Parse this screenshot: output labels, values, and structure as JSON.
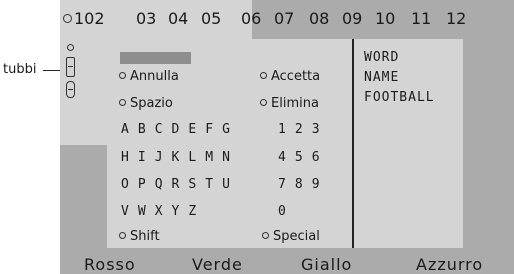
{
  "callout": "tubbi",
  "channels": [
    "102",
    "03",
    "04",
    "05",
    "06",
    "07",
    "08",
    "09",
    "10",
    "11",
    "12"
  ],
  "options": {
    "cancel": "Annulla",
    "accept": "Accetta",
    "space": "Spazio",
    "delete": "Elimina",
    "shift": "Shift",
    "special": "Special"
  },
  "keyboard": {
    "letters": [
      "A B C D E F G",
      "H I J K L M N",
      "O P Q R S T U",
      "V W X Y Z"
    ],
    "digits": [
      "1 2 3",
      "4 5 6",
      "7 8 9",
      "0"
    ]
  },
  "words": [
    "WORD",
    "NAME",
    "FOOTBALL"
  ],
  "color_keys": {
    "red": "Rosso",
    "green": "Verde",
    "yellow": "Giallo",
    "blue": "Azzurro"
  },
  "colors": {
    "background_dark": "#ababab",
    "background_light": "#d4d4d4",
    "input_box": "#8e8e8e"
  }
}
